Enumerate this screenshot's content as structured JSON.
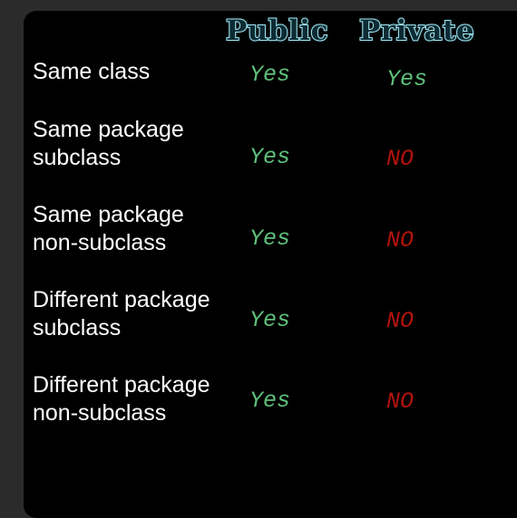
{
  "headers": {
    "public": "Public",
    "private": "Private"
  },
  "rows": [
    {
      "label_line1": "Same class",
      "label_line2": "",
      "public": "Yes",
      "private": "Yes"
    },
    {
      "label_line1": "Same package",
      "label_line2": "subclass",
      "public": "Yes",
      "private": "NO"
    },
    {
      "label_line1": "Same package",
      "label_line2": "non-subclass",
      "public": "Yes",
      "private": "NO"
    },
    {
      "label_line1": "Different package",
      "label_line2": "subclass",
      "public": "Yes",
      "private": "NO"
    },
    {
      "label_line1": "Different package",
      "label_line2": "non-subclass",
      "public": "Yes",
      "private": "NO"
    }
  ],
  "colors": {
    "background": "#000000",
    "label_text": "#ffffff",
    "yes": "#5fbf7a",
    "no": "#b3120c",
    "header_outline": "#9fe6f2"
  }
}
